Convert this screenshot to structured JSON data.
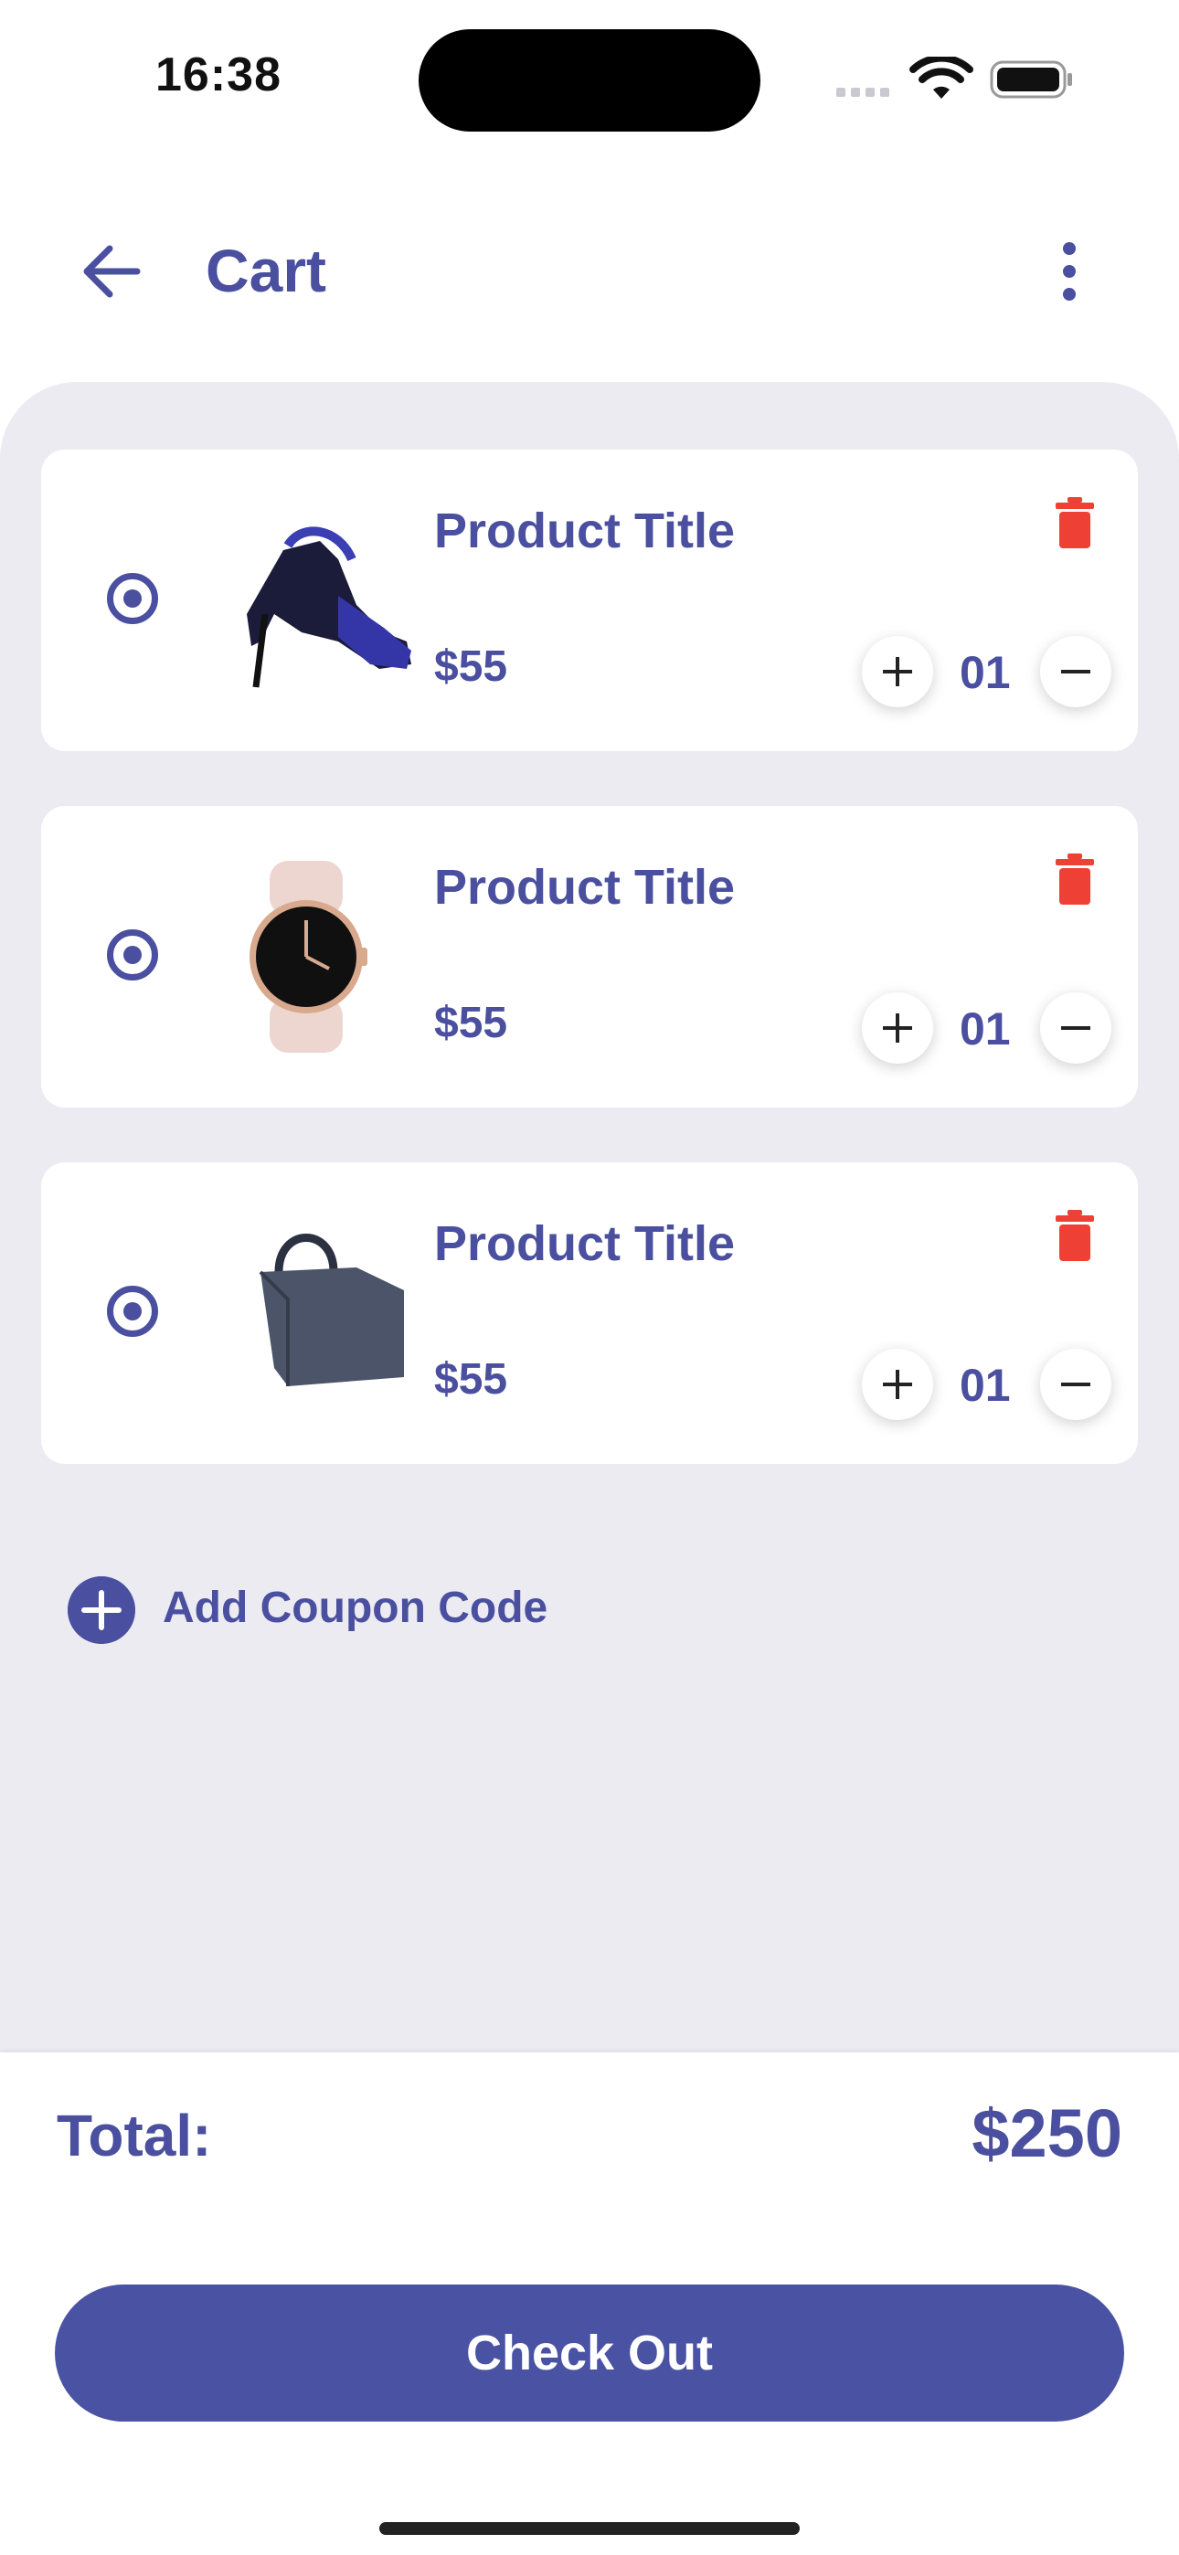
{
  "status_bar": {
    "time": "16:38"
  },
  "header": {
    "title": "Cart",
    "back_icon": "arrow-left-icon",
    "menu_icon": "more-vertical-icon"
  },
  "cart": {
    "items": [
      {
        "title": "Product Title",
        "price": "$55",
        "quantity": "01",
        "selected": true,
        "image": "sandal-heel"
      },
      {
        "title": "Product Title",
        "price": "$55",
        "quantity": "01",
        "selected": true,
        "image": "smart-watch"
      },
      {
        "title": "Product Title",
        "price": "$55",
        "quantity": "01",
        "selected": true,
        "image": "laptop-bag"
      }
    ]
  },
  "coupon": {
    "label": "Add Coupon Code"
  },
  "summary": {
    "total_label": "Total:",
    "total_value": "$250"
  },
  "checkout": {
    "label": "Check Out"
  },
  "colors": {
    "primary": "#4a4f9f",
    "delete": "#ef4035",
    "background": "#ecebf2"
  }
}
